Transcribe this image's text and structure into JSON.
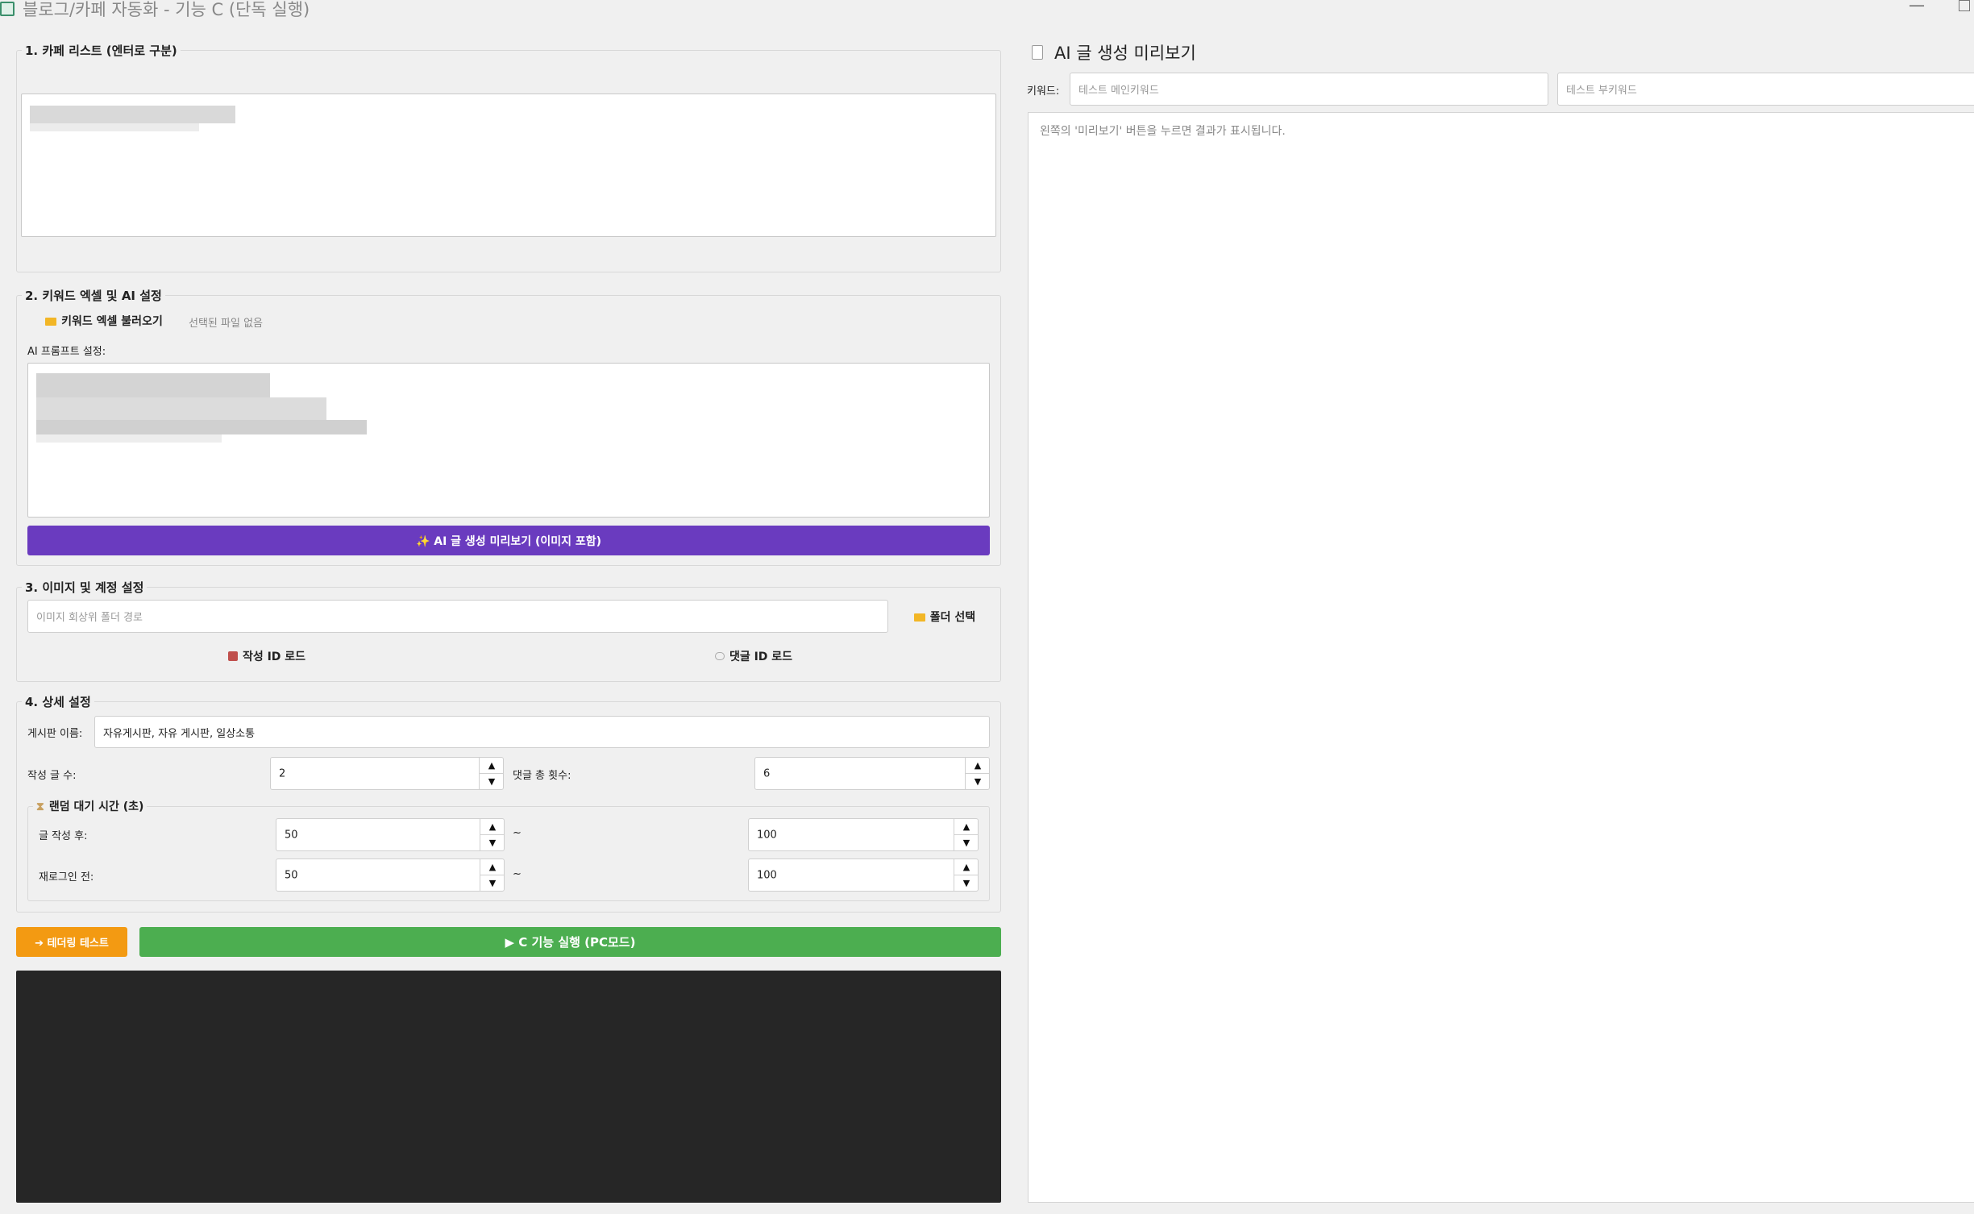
{
  "window": {
    "title": "블로그/카페 자동화 - 기능 C (단독 실행)",
    "minimize": "—"
  },
  "section1": {
    "title": "1. 카페 리스트 (엔터로 구분)"
  },
  "section2": {
    "title": "2. 키워드 엑셀 및 AI 설정",
    "excel_button": "키워드 엑셀 불러오기",
    "file_status": "선택된 파일 없음",
    "prompt_label": "AI 프롬프트 설정:",
    "preview_button": "✨ AI 글 생성 미리보기 (이미지 포함)"
  },
  "section3": {
    "title": "3. 이미지 및 계정 설정",
    "image_folder_placeholder": "이미지 회상위 폴더 경로",
    "folder_button": "폴더 선택",
    "writer_id_button": "작성 ID 로드",
    "comment_id_button": "댓글 ID 로드"
  },
  "section4": {
    "title": "4. 상세 설정",
    "board_label": "게시판 이름:",
    "board_value": "자유게시판, 자유 게시판, 일상소통",
    "post_count_label": "작성 글 수:",
    "post_count": "2",
    "comment_count_label": "댓글 총 횟수:",
    "comment_count": "6",
    "wait": {
      "title": "랜덤 대기 시간 (초)",
      "after_post_label": "글 작성 후:",
      "after_post_min": "50",
      "after_post_max": "100",
      "relogin_label": "재로그인 전:",
      "relogin_min": "50",
      "relogin_max": "100",
      "tilde": "~"
    }
  },
  "actions": {
    "tethering_button": "➔ 테더링 테스트",
    "run_button": "▶ C 기능 실행 (PC모드)"
  },
  "preview": {
    "title": "AI 글 생성 미리보기",
    "keyword_label": "키워드:",
    "main_keyword_placeholder": "테스트 메인키워드",
    "sub_keyword_placeholder": "테스트 부키워드",
    "result_placeholder": "왼쪽의 '미리보기' 버튼을 누르면 결과가 표시됩니다."
  },
  "colors": {
    "purple": "#6a3bbf",
    "orange": "#f39a12",
    "green": "#4cae50",
    "console": "#262626"
  }
}
